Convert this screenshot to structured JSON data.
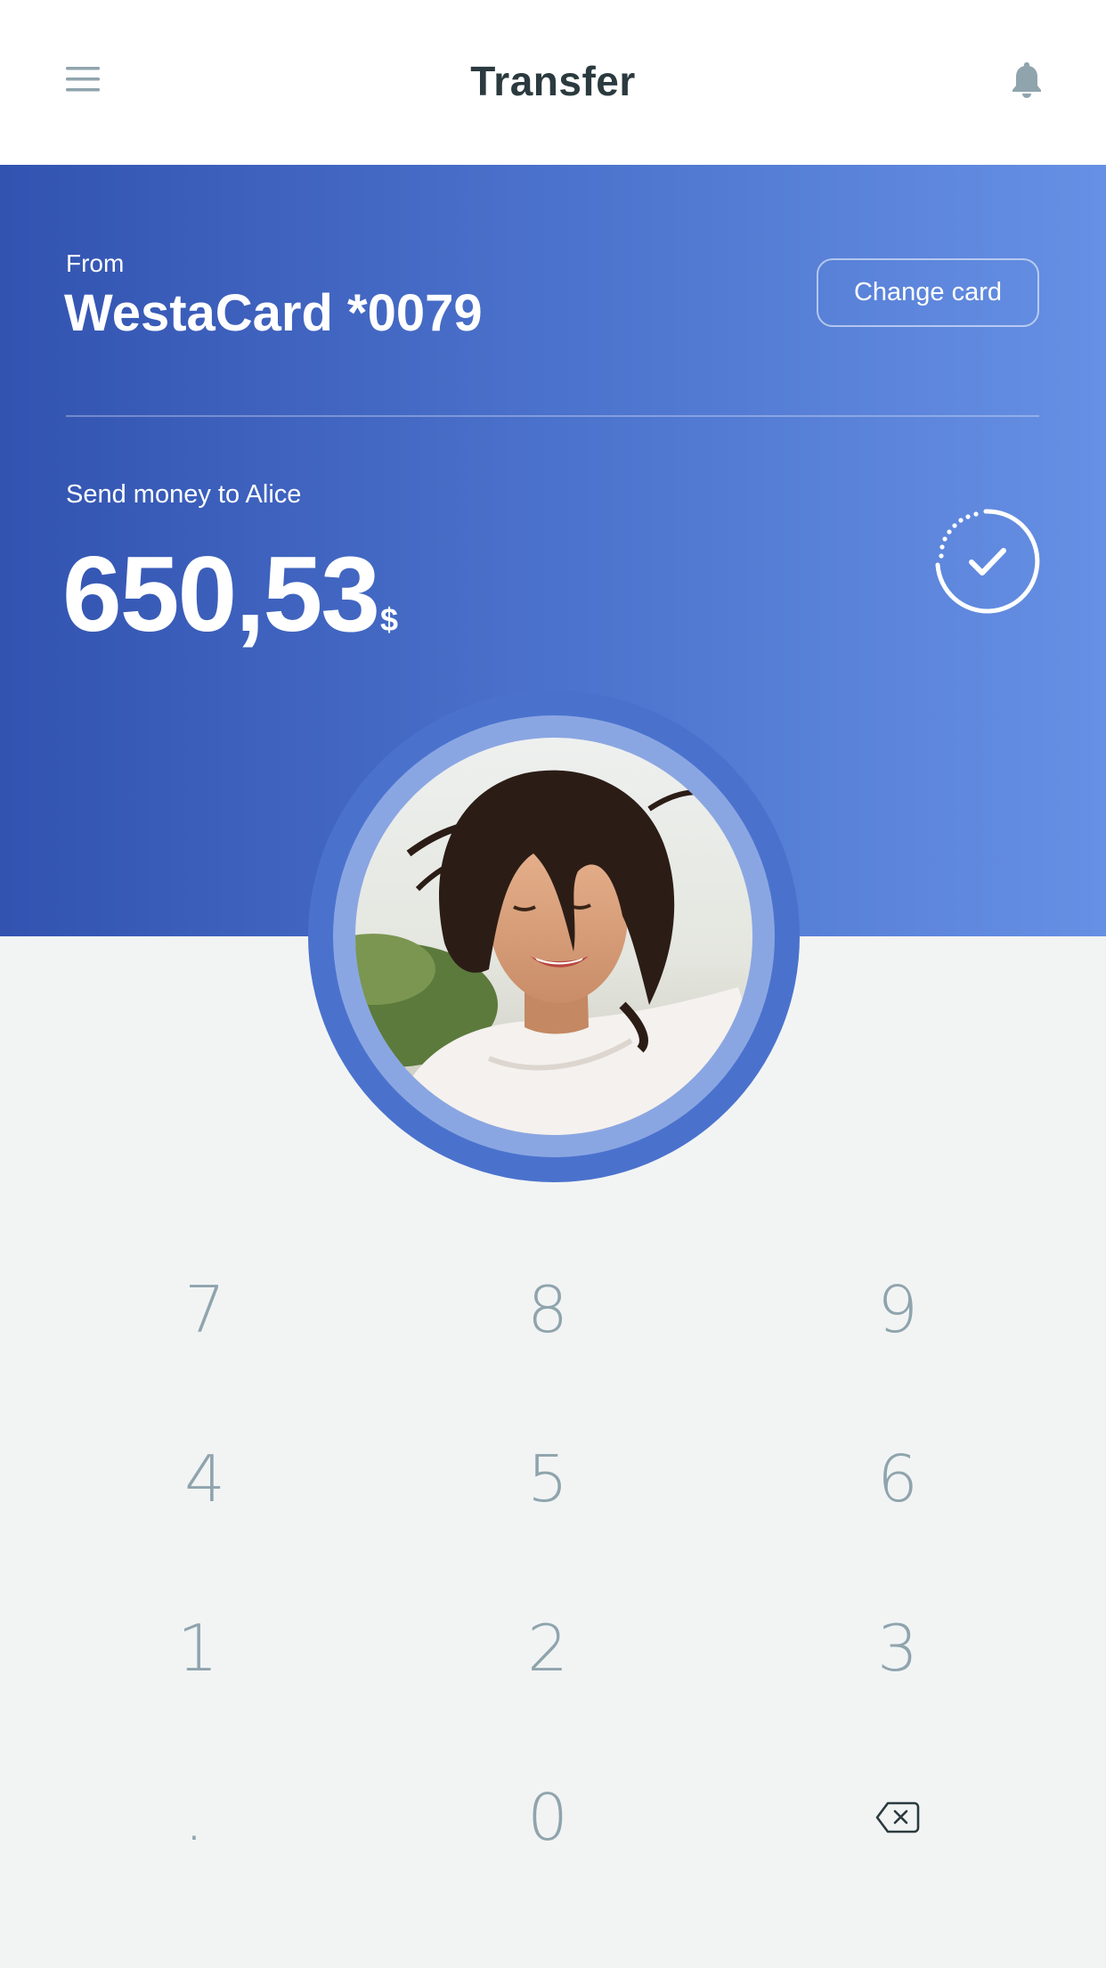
{
  "header": {
    "title": "Transfer",
    "menu_icon": "hamburger-menu-icon",
    "notification_icon": "bell-icon"
  },
  "source_card": {
    "label": "From",
    "name": "WestaCard *0079",
    "change_button": "Change card"
  },
  "transfer": {
    "label": "Send money to Alice",
    "amount": "650,53",
    "currency": "$",
    "confirm_icon": "check-circle-icon"
  },
  "recipient": {
    "avatar": "avatar-photo"
  },
  "keypad": {
    "keys": [
      "7",
      "8",
      "9",
      "4",
      "5",
      "6",
      "1",
      "2",
      "3",
      ".",
      "0"
    ],
    "backspace_icon": "backspace-icon"
  },
  "colors": {
    "hero_gradient_start": "#3253b0",
    "hero_gradient_end": "#6690e4",
    "keypad_background": "#f2f4f4",
    "key_text": "#8fa4ad",
    "title_text": "#2b3a3e"
  }
}
